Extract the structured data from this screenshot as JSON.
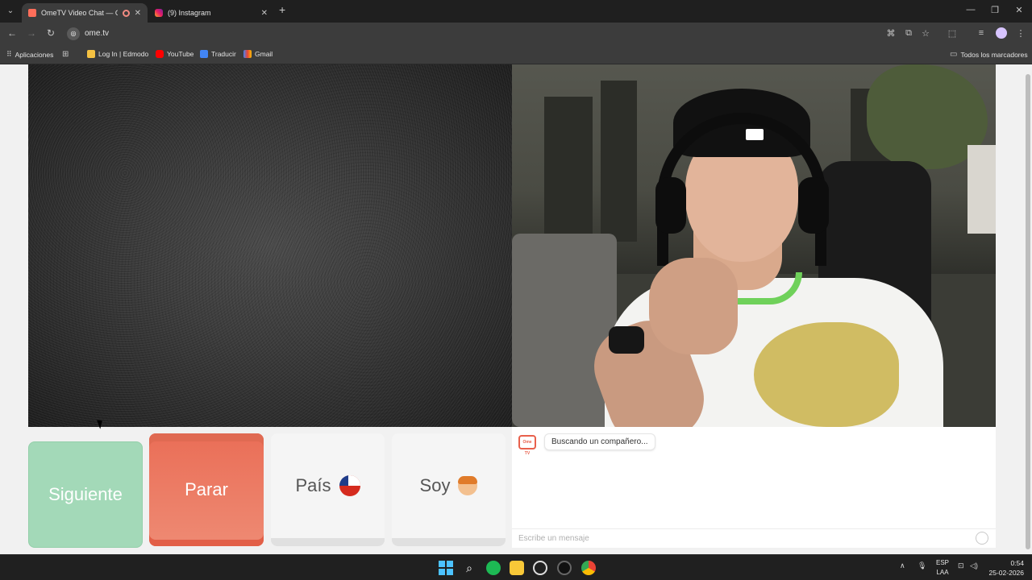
{
  "browser": {
    "tabs": [
      {
        "title": "OmeTV Video Chat — Ome",
        "active": true
      },
      {
        "title": "(9) Instagram",
        "active": false
      }
    ],
    "url": "ome.tv",
    "bookmarks": [
      {
        "label": "Aplicaciones"
      },
      {
        "label": "Log In | Edmodo"
      },
      {
        "label": "YouTube"
      },
      {
        "label": "Traducir"
      },
      {
        "label": "Gmail"
      }
    ],
    "all_bookmarks_label": "Todos los marcadores"
  },
  "controls": {
    "next_label": "Siguiente",
    "stop_label": "Parar",
    "country_label": "País",
    "gender_label": "Soy"
  },
  "chat": {
    "status_message": "Buscando un compañero...",
    "input_placeholder": "Escribe un mensaje",
    "logo_text": "Ome TV"
  },
  "taskbar": {
    "language": "ESP",
    "language_sub": "LAA",
    "time": "0:54",
    "date": "25-02-2026"
  },
  "colors": {
    "next_button": "#a3d9b8",
    "stop_button": "#ea6e57",
    "accent": "#e8604c"
  }
}
